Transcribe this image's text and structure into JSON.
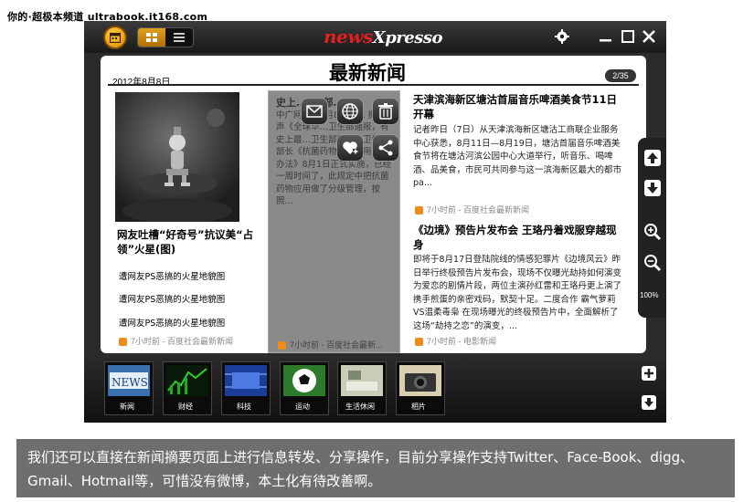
{
  "watermark": "你的·超极本频道 ultrabook.it168.com",
  "app": {
    "logo_main": "news",
    "logo_sub": "Xpresso",
    "header": {
      "date": "2012年8月8日",
      "title": "最新新闻",
      "page_indicator": "2/35"
    },
    "column1": {
      "headline": "网友吐槽“好奇号”抗议美“占领”火星(图)",
      "links": [
        "遭网友PS恶搞的火星地貌图",
        "遭网友PS恶搞的火星地貌图",
        "遭网友PS恶搞的火星地貌图"
      ],
      "source": "7小时前 - 百度社会最新新闻"
    },
    "column2": {
      "headline": "史上… 国 部…",
      "body": "中广网北京8月8日消息 据之声《全球华…卫生部通报，有史上最…卫生部制定的卫生部部长《抗菌药物临床应用管理办法》8月1日正式实施，已经一周时间了，此规定中把抗菌药物应用做了分级管理，按照…",
      "source": "7小时前 - 百度社会最新..."
    },
    "column3": {
      "articles": [
        {
          "title": "天津滨海新区塘沽首届音乐啤酒美食节11日开幕",
          "body": "记者昨日（7日）从天津滨海新区塘沽工商联企业服务中心获悉，8月11日—8月19日，塘沽首届音乐啤酒美食节将在塘沽河滨公园中心大道举行，听音乐、喝啤酒、品美食，市民可共同参与这一滨海新区最大的都市pa...",
          "source": "7小时前 - 百度社会最新新闻"
        },
        {
          "title": "《边境》预告片发布会 王珞丹着戏服穿越现身",
          "body": "即将于8月17日登陆院线的情感犯罪片《边境风云》昨日举行终极预告片发布会，现场不仅曝光劫持如何演变为爱恋的剧情片段，两位主演孙红雷和王珞丹更上演了携手煎蛋的亲密戏码，默契十足。二度合作 霸气萝莉VS温柔毒枭 在现场曝光的终极预告片中，全面解析了这场“劫持之恋”的演变，...",
          "source": "7小时前 - 电影新闻"
        }
      ]
    },
    "zoom_level": "100%",
    "categories": [
      {
        "label": "新闻",
        "icon": "news-thumb"
      },
      {
        "label": "财经",
        "icon": "finance-thumb"
      },
      {
        "label": "科技",
        "icon": "tech-thumb"
      },
      {
        "label": "运动",
        "icon": "sports-thumb"
      },
      {
        "label": "生活休闲",
        "icon": "lifestyle-thumb"
      },
      {
        "label": "相片",
        "icon": "photo-thumb"
      }
    ],
    "colors": {
      "accent": "#f0a020",
      "brand_red": "#e02020",
      "rss": "#f08a18"
    }
  },
  "caption": "我们还可以直接在新闻摘要页面上进行信息转发、分享操作，目前分享操作支持Twitter、Face-Book、digg、Gmail、Hotmail等，可惜没有微博，本土化有待改善啊。"
}
